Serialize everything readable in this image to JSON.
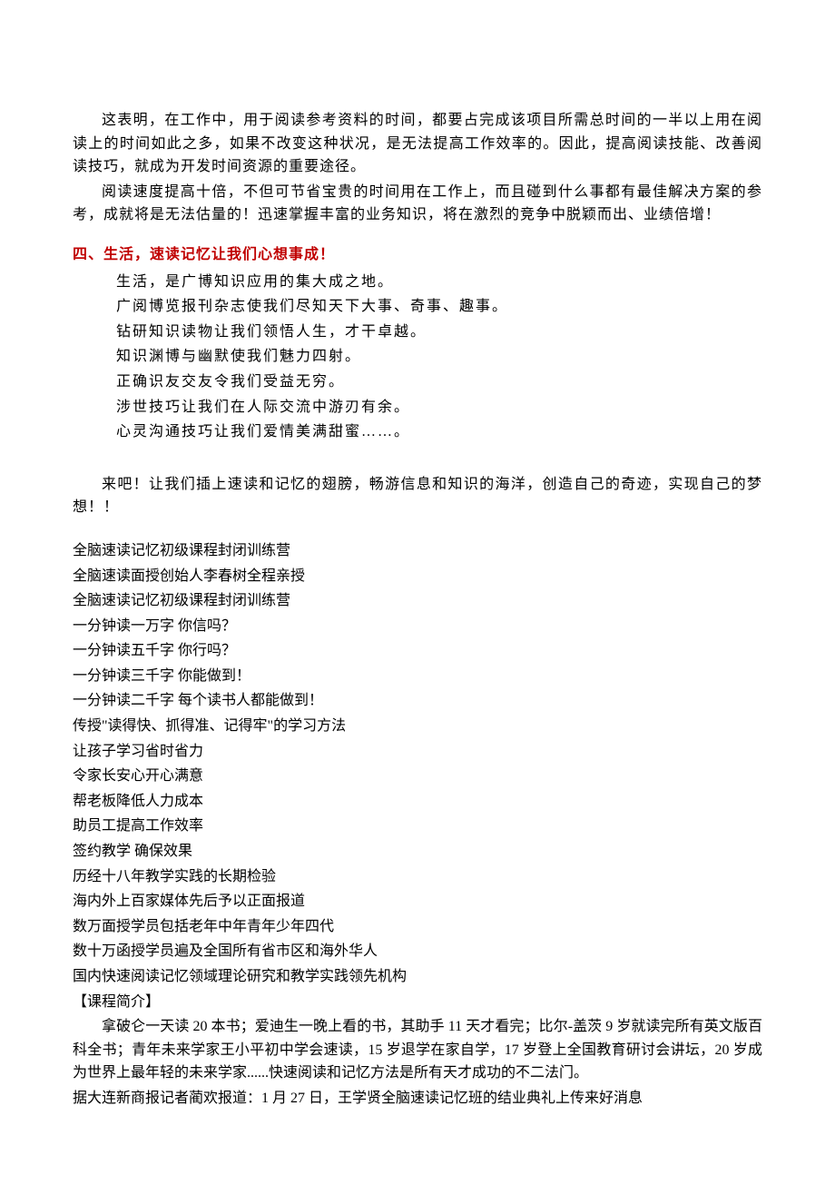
{
  "section1": {
    "p1": "这表明，在工作中，用于阅读参考资料的时间，都要占完成该项目所需总时间的一半以上用在阅读上的时间如此之多，如果不改变这种状况，是无法提高工作效率的。因此，提高阅读技能、改善阅读技巧，就成为开发时间资源的重要途径。",
    "p2": "阅读速度提高十倍，不但可节省宝贵的时间用在工作上，而且碰到什么事都有最佳解决方案的参考，成就将是无法估量的！迅速掌握丰富的业务知识，将在激烈的竞争中脱颖而出、业绩倍增！"
  },
  "section2": {
    "heading": "四、生活，速读记忆让我们心想事成！",
    "lines": [
      "生活，是广博知识应用的集大成之地。",
      "广阅博览报刊杂志使我们尽知天下大事、奇事、趣事。",
      "钻研知识读物让我们领悟人生，才干卓越。",
      "知识渊博与幽默使我们魅力四射。",
      "正确识友交友令我们受益无穷。",
      "涉世技巧让我们在人际交流中游刃有余。",
      "心灵沟通技巧让我们爱情美满甜蜜……。"
    ]
  },
  "closing": {
    "p1": "来吧！让我们插上速读和记忆的翅膀，畅游信息和知识的海洋，创造自己的奇迹，实现自己的梦想！！"
  },
  "course": {
    "items": [
      "全脑速读记忆初级课程封闭训练营",
      "全脑速读面授创始人李春树全程亲授",
      "全脑速读记忆初级课程封闭训练营",
      "一分钟读一万字 你信吗？",
      "一分钟读五千字 你行吗？",
      "一分钟读三千字 你能做到！",
      "一分钟读二千字 每个读书人都能做到！",
      "传授\"读得快、抓得准、记得牢\"的学习方法",
      "让孩子学习省时省力",
      "令家长安心开心满意",
      "帮老板降低人力成本",
      "助员工提高工作效率",
      "签约教学 确保效果",
      "历经十八年教学实践的长期检验",
      "海内外上百家媒体先后予以正面报道",
      "数万面授学员包括老年中年青年少年四代",
      "数十万函授学员遍及全国所有省市区和海外华人",
      "国内快速阅读记忆领域理论研究和教学实践领先机构"
    ],
    "intro_heading": "【课程简介】",
    "intro_p1": "拿破仑一天读 20 本书；爱迪生一晚上看的书，其助手 11 天才看完；比尔-盖茨 9 岁就读完所有英文版百科全书；青年未来学家王小平初中学会速读，15 岁退学在家自学，17 岁登上全国教育研讨会讲坛，20 岁成为世界上最年轻的未来学家......快速阅读和记忆方法是所有天才成功的不二法门。",
    "intro_p2": "据大连新商报记者蔺欢报道：1 月 27 日，王学贤全脑速读记忆班的结业典礼上传来好消息"
  }
}
